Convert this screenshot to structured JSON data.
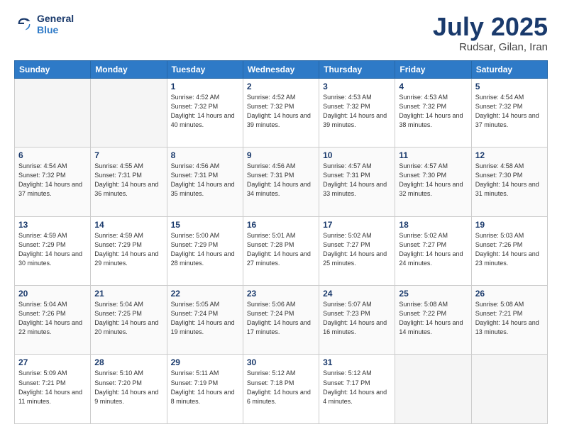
{
  "header": {
    "logo_line1": "General",
    "logo_line2": "Blue",
    "title": "July 2025",
    "subtitle": "Rudsar, Gilan, Iran"
  },
  "days_of_week": [
    "Sunday",
    "Monday",
    "Tuesday",
    "Wednesday",
    "Thursday",
    "Friday",
    "Saturday"
  ],
  "weeks": [
    [
      {
        "day": "",
        "empty": true
      },
      {
        "day": "",
        "empty": true
      },
      {
        "day": "1",
        "sunrise": "4:52 AM",
        "sunset": "7:32 PM",
        "daylight": "14 hours and 40 minutes."
      },
      {
        "day": "2",
        "sunrise": "4:52 AM",
        "sunset": "7:32 PM",
        "daylight": "14 hours and 39 minutes."
      },
      {
        "day": "3",
        "sunrise": "4:53 AM",
        "sunset": "7:32 PM",
        "daylight": "14 hours and 39 minutes."
      },
      {
        "day": "4",
        "sunrise": "4:53 AM",
        "sunset": "7:32 PM",
        "daylight": "14 hours and 38 minutes."
      },
      {
        "day": "5",
        "sunrise": "4:54 AM",
        "sunset": "7:32 PM",
        "daylight": "14 hours and 37 minutes."
      }
    ],
    [
      {
        "day": "6",
        "sunrise": "4:54 AM",
        "sunset": "7:32 PM",
        "daylight": "14 hours and 37 minutes."
      },
      {
        "day": "7",
        "sunrise": "4:55 AM",
        "sunset": "7:31 PM",
        "daylight": "14 hours and 36 minutes."
      },
      {
        "day": "8",
        "sunrise": "4:56 AM",
        "sunset": "7:31 PM",
        "daylight": "14 hours and 35 minutes."
      },
      {
        "day": "9",
        "sunrise": "4:56 AM",
        "sunset": "7:31 PM",
        "daylight": "14 hours and 34 minutes."
      },
      {
        "day": "10",
        "sunrise": "4:57 AM",
        "sunset": "7:31 PM",
        "daylight": "14 hours and 33 minutes."
      },
      {
        "day": "11",
        "sunrise": "4:57 AM",
        "sunset": "7:30 PM",
        "daylight": "14 hours and 32 minutes."
      },
      {
        "day": "12",
        "sunrise": "4:58 AM",
        "sunset": "7:30 PM",
        "daylight": "14 hours and 31 minutes."
      }
    ],
    [
      {
        "day": "13",
        "sunrise": "4:59 AM",
        "sunset": "7:29 PM",
        "daylight": "14 hours and 30 minutes."
      },
      {
        "day": "14",
        "sunrise": "4:59 AM",
        "sunset": "7:29 PM",
        "daylight": "14 hours and 29 minutes."
      },
      {
        "day": "15",
        "sunrise": "5:00 AM",
        "sunset": "7:29 PM",
        "daylight": "14 hours and 28 minutes."
      },
      {
        "day": "16",
        "sunrise": "5:01 AM",
        "sunset": "7:28 PM",
        "daylight": "14 hours and 27 minutes."
      },
      {
        "day": "17",
        "sunrise": "5:02 AM",
        "sunset": "7:27 PM",
        "daylight": "14 hours and 25 minutes."
      },
      {
        "day": "18",
        "sunrise": "5:02 AM",
        "sunset": "7:27 PM",
        "daylight": "14 hours and 24 minutes."
      },
      {
        "day": "19",
        "sunrise": "5:03 AM",
        "sunset": "7:26 PM",
        "daylight": "14 hours and 23 minutes."
      }
    ],
    [
      {
        "day": "20",
        "sunrise": "5:04 AM",
        "sunset": "7:26 PM",
        "daylight": "14 hours and 22 minutes."
      },
      {
        "day": "21",
        "sunrise": "5:04 AM",
        "sunset": "7:25 PM",
        "daylight": "14 hours and 20 minutes."
      },
      {
        "day": "22",
        "sunrise": "5:05 AM",
        "sunset": "7:24 PM",
        "daylight": "14 hours and 19 minutes."
      },
      {
        "day": "23",
        "sunrise": "5:06 AM",
        "sunset": "7:24 PM",
        "daylight": "14 hours and 17 minutes."
      },
      {
        "day": "24",
        "sunrise": "5:07 AM",
        "sunset": "7:23 PM",
        "daylight": "14 hours and 16 minutes."
      },
      {
        "day": "25",
        "sunrise": "5:08 AM",
        "sunset": "7:22 PM",
        "daylight": "14 hours and 14 minutes."
      },
      {
        "day": "26",
        "sunrise": "5:08 AM",
        "sunset": "7:21 PM",
        "daylight": "14 hours and 13 minutes."
      }
    ],
    [
      {
        "day": "27",
        "sunrise": "5:09 AM",
        "sunset": "7:21 PM",
        "daylight": "14 hours and 11 minutes."
      },
      {
        "day": "28",
        "sunrise": "5:10 AM",
        "sunset": "7:20 PM",
        "daylight": "14 hours and 9 minutes."
      },
      {
        "day": "29",
        "sunrise": "5:11 AM",
        "sunset": "7:19 PM",
        "daylight": "14 hours and 8 minutes."
      },
      {
        "day": "30",
        "sunrise": "5:12 AM",
        "sunset": "7:18 PM",
        "daylight": "14 hours and 6 minutes."
      },
      {
        "day": "31",
        "sunrise": "5:12 AM",
        "sunset": "7:17 PM",
        "daylight": "14 hours and 4 minutes."
      },
      {
        "day": "",
        "empty": true
      },
      {
        "day": "",
        "empty": true
      }
    ]
  ]
}
